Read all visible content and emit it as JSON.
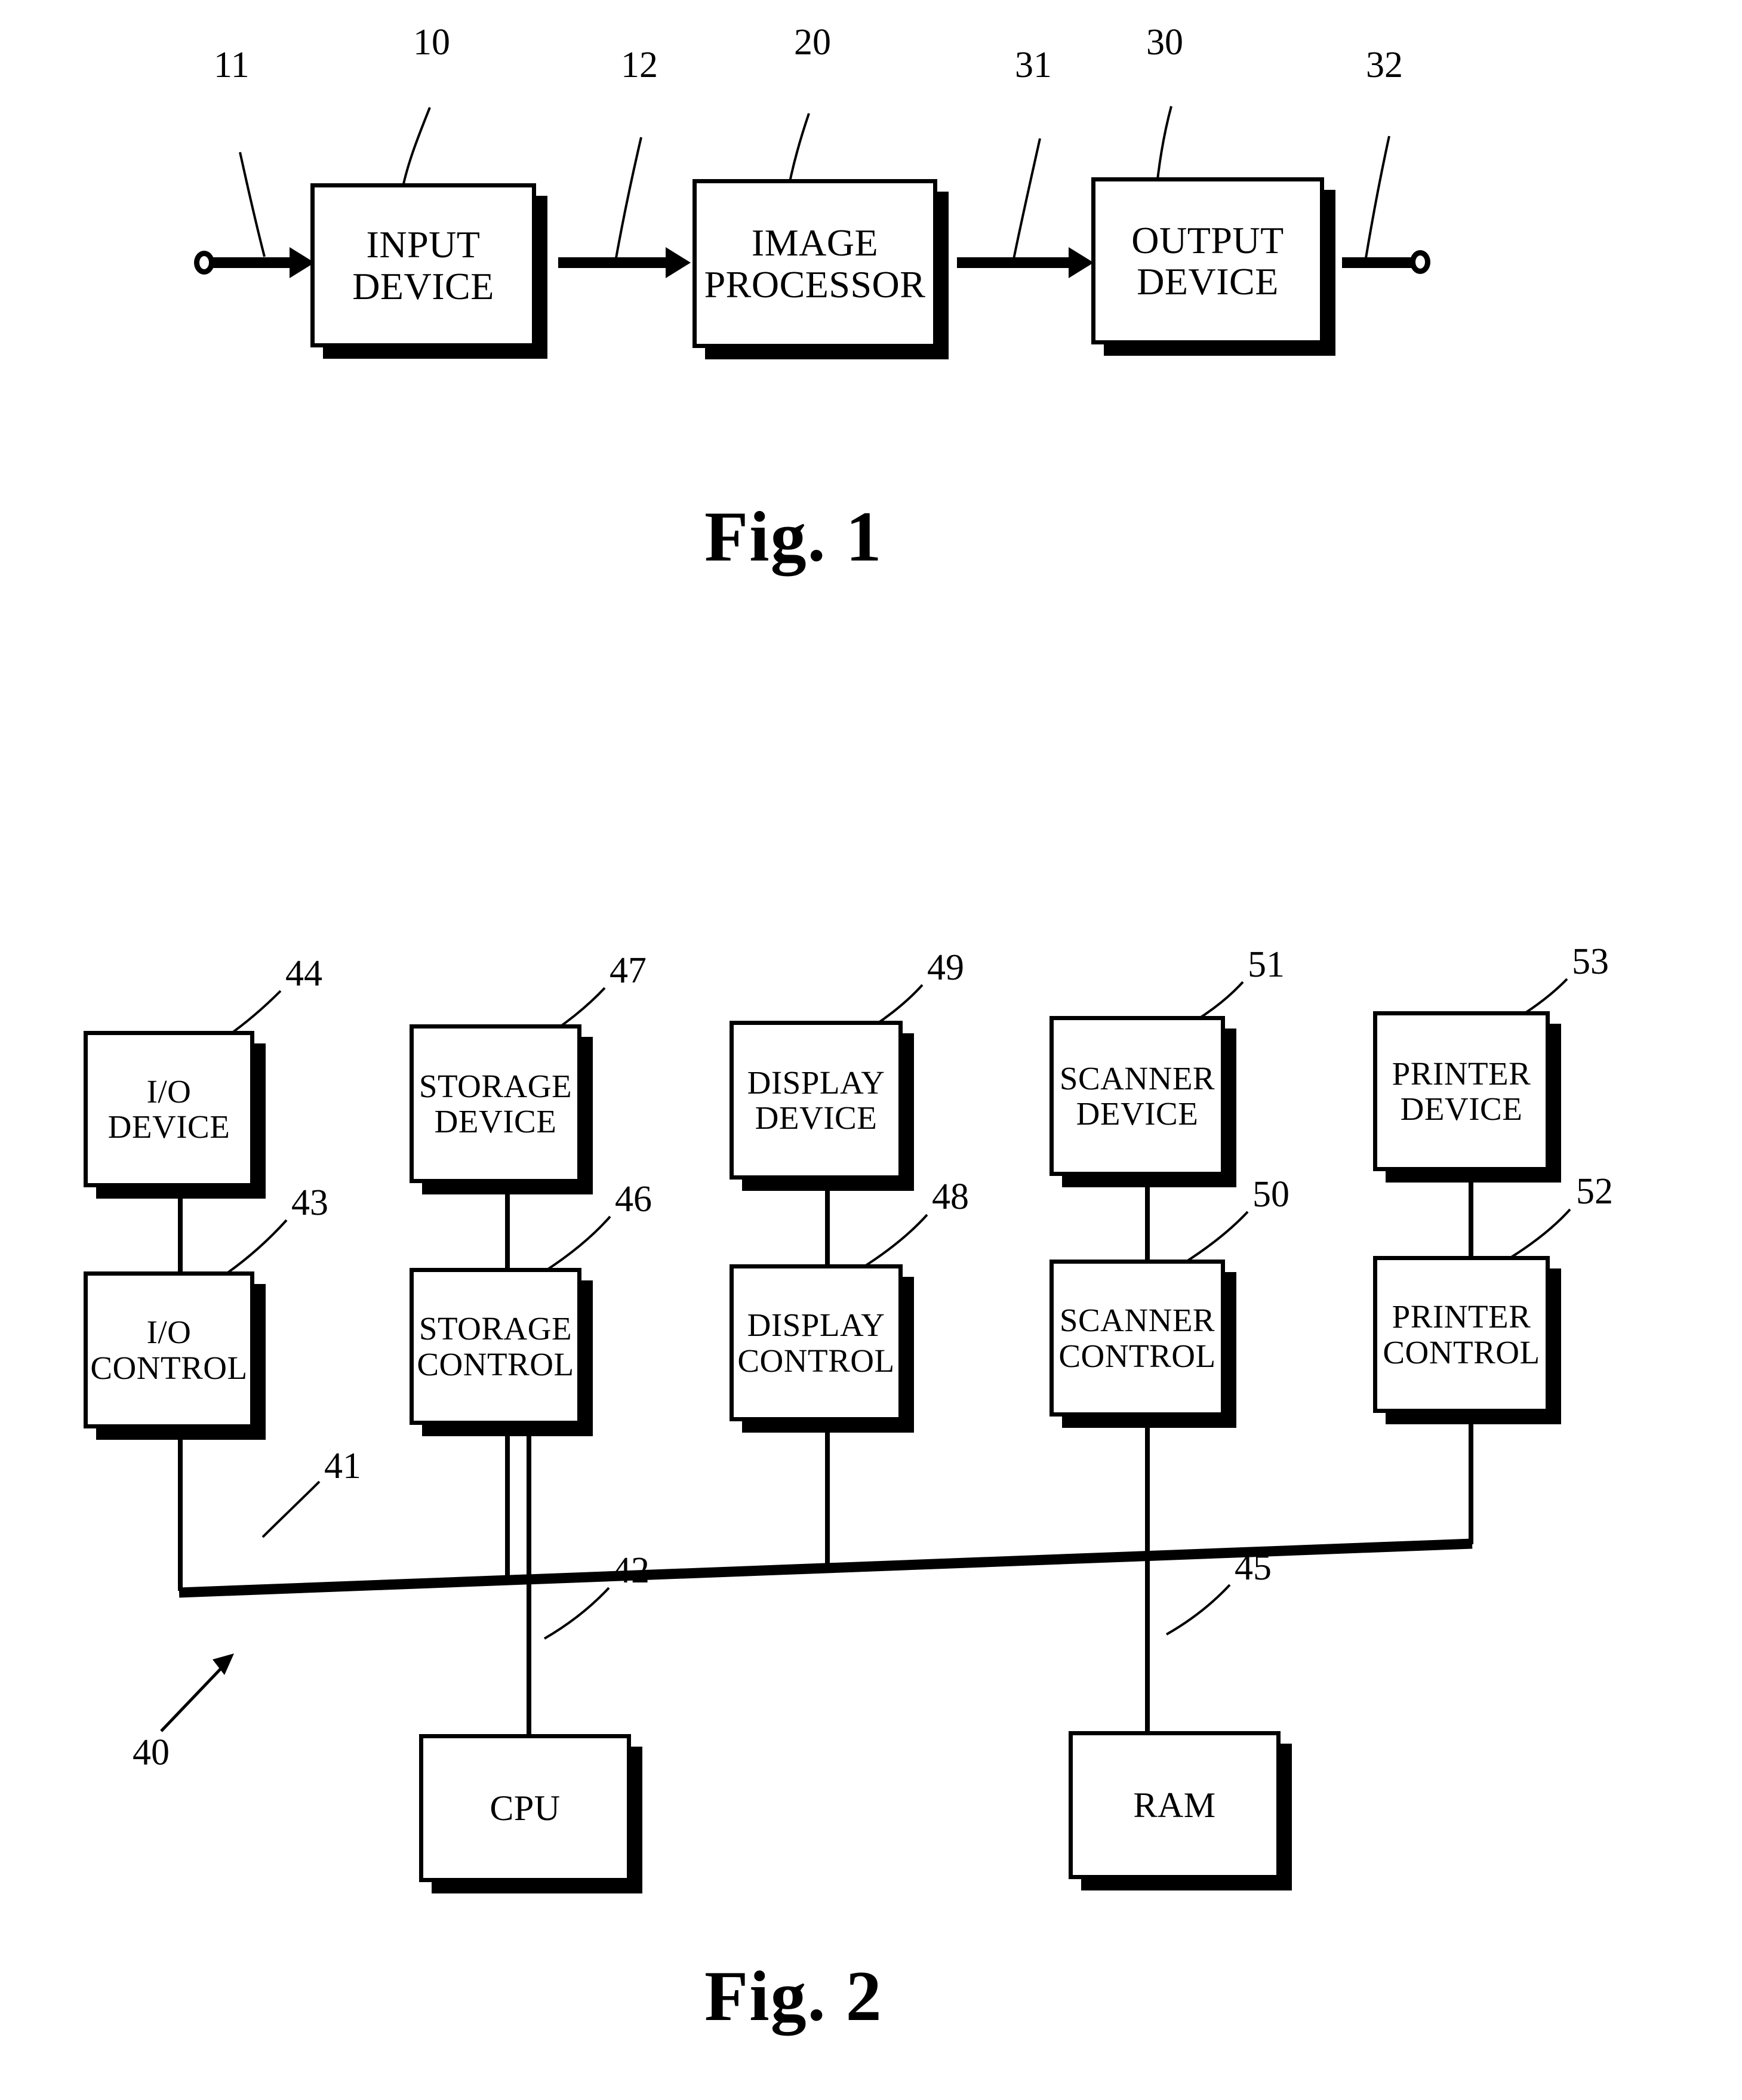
{
  "figure1": {
    "caption": "Fig. 1",
    "blocks": [
      {
        "id": "input-device",
        "line1": "INPUT",
        "line2": "DEVICE",
        "ref": "10"
      },
      {
        "id": "image-processor",
        "line1": "IMAGE",
        "line2": "PROCESSOR",
        "ref": "20"
      },
      {
        "id": "output-device",
        "line1": "OUTPUT",
        "line2": "DEVICE",
        "ref": "30"
      }
    ],
    "signal_refs": [
      {
        "id": "input-signal-ref",
        "ref": "11"
      },
      {
        "id": "image-signal-ref",
        "ref": "12"
      },
      {
        "id": "output-signal-ref",
        "ref": "31"
      },
      {
        "id": "final-signal-ref",
        "ref": "32"
      }
    ]
  },
  "figure2": {
    "caption": "Fig. 2",
    "system_ref": "40",
    "bus_ref": "41",
    "devices": [
      {
        "id": "io-device",
        "line1": "I/O",
        "line2": "DEVICE",
        "ref": "44"
      },
      {
        "id": "storage-device",
        "line1": "STORAGE",
        "line2": "DEVICE",
        "ref": "47"
      },
      {
        "id": "display-device",
        "line1": "DISPLAY",
        "line2": "DEVICE",
        "ref": "49"
      },
      {
        "id": "scanner-device",
        "line1": "SCANNER",
        "line2": "DEVICE",
        "ref": "51"
      },
      {
        "id": "printer-device",
        "line1": "PRINTER",
        "line2": "DEVICE",
        "ref": "53"
      }
    ],
    "controls": [
      {
        "id": "io-control",
        "line1": "I/O",
        "line2": "CONTROL",
        "ref": "43"
      },
      {
        "id": "storage-control",
        "line1": "STORAGE",
        "line2": "CONTROL",
        "ref": "46"
      },
      {
        "id": "display-control",
        "line1": "DISPLAY",
        "line2": "CONTROL",
        "ref": "48"
      },
      {
        "id": "scanner-control",
        "line1": "SCANNER",
        "line2": "CONTROL",
        "ref": "50"
      },
      {
        "id": "printer-control",
        "line1": "PRINTER",
        "line2": "CONTROL",
        "ref": "52"
      }
    ],
    "core": [
      {
        "id": "cpu",
        "line1": "CPU",
        "ref": "42"
      },
      {
        "id": "ram",
        "line1": "RAM",
        "ref": "45"
      }
    ]
  },
  "colors": {
    "ink": "#000000",
    "paper": "#ffffff"
  }
}
